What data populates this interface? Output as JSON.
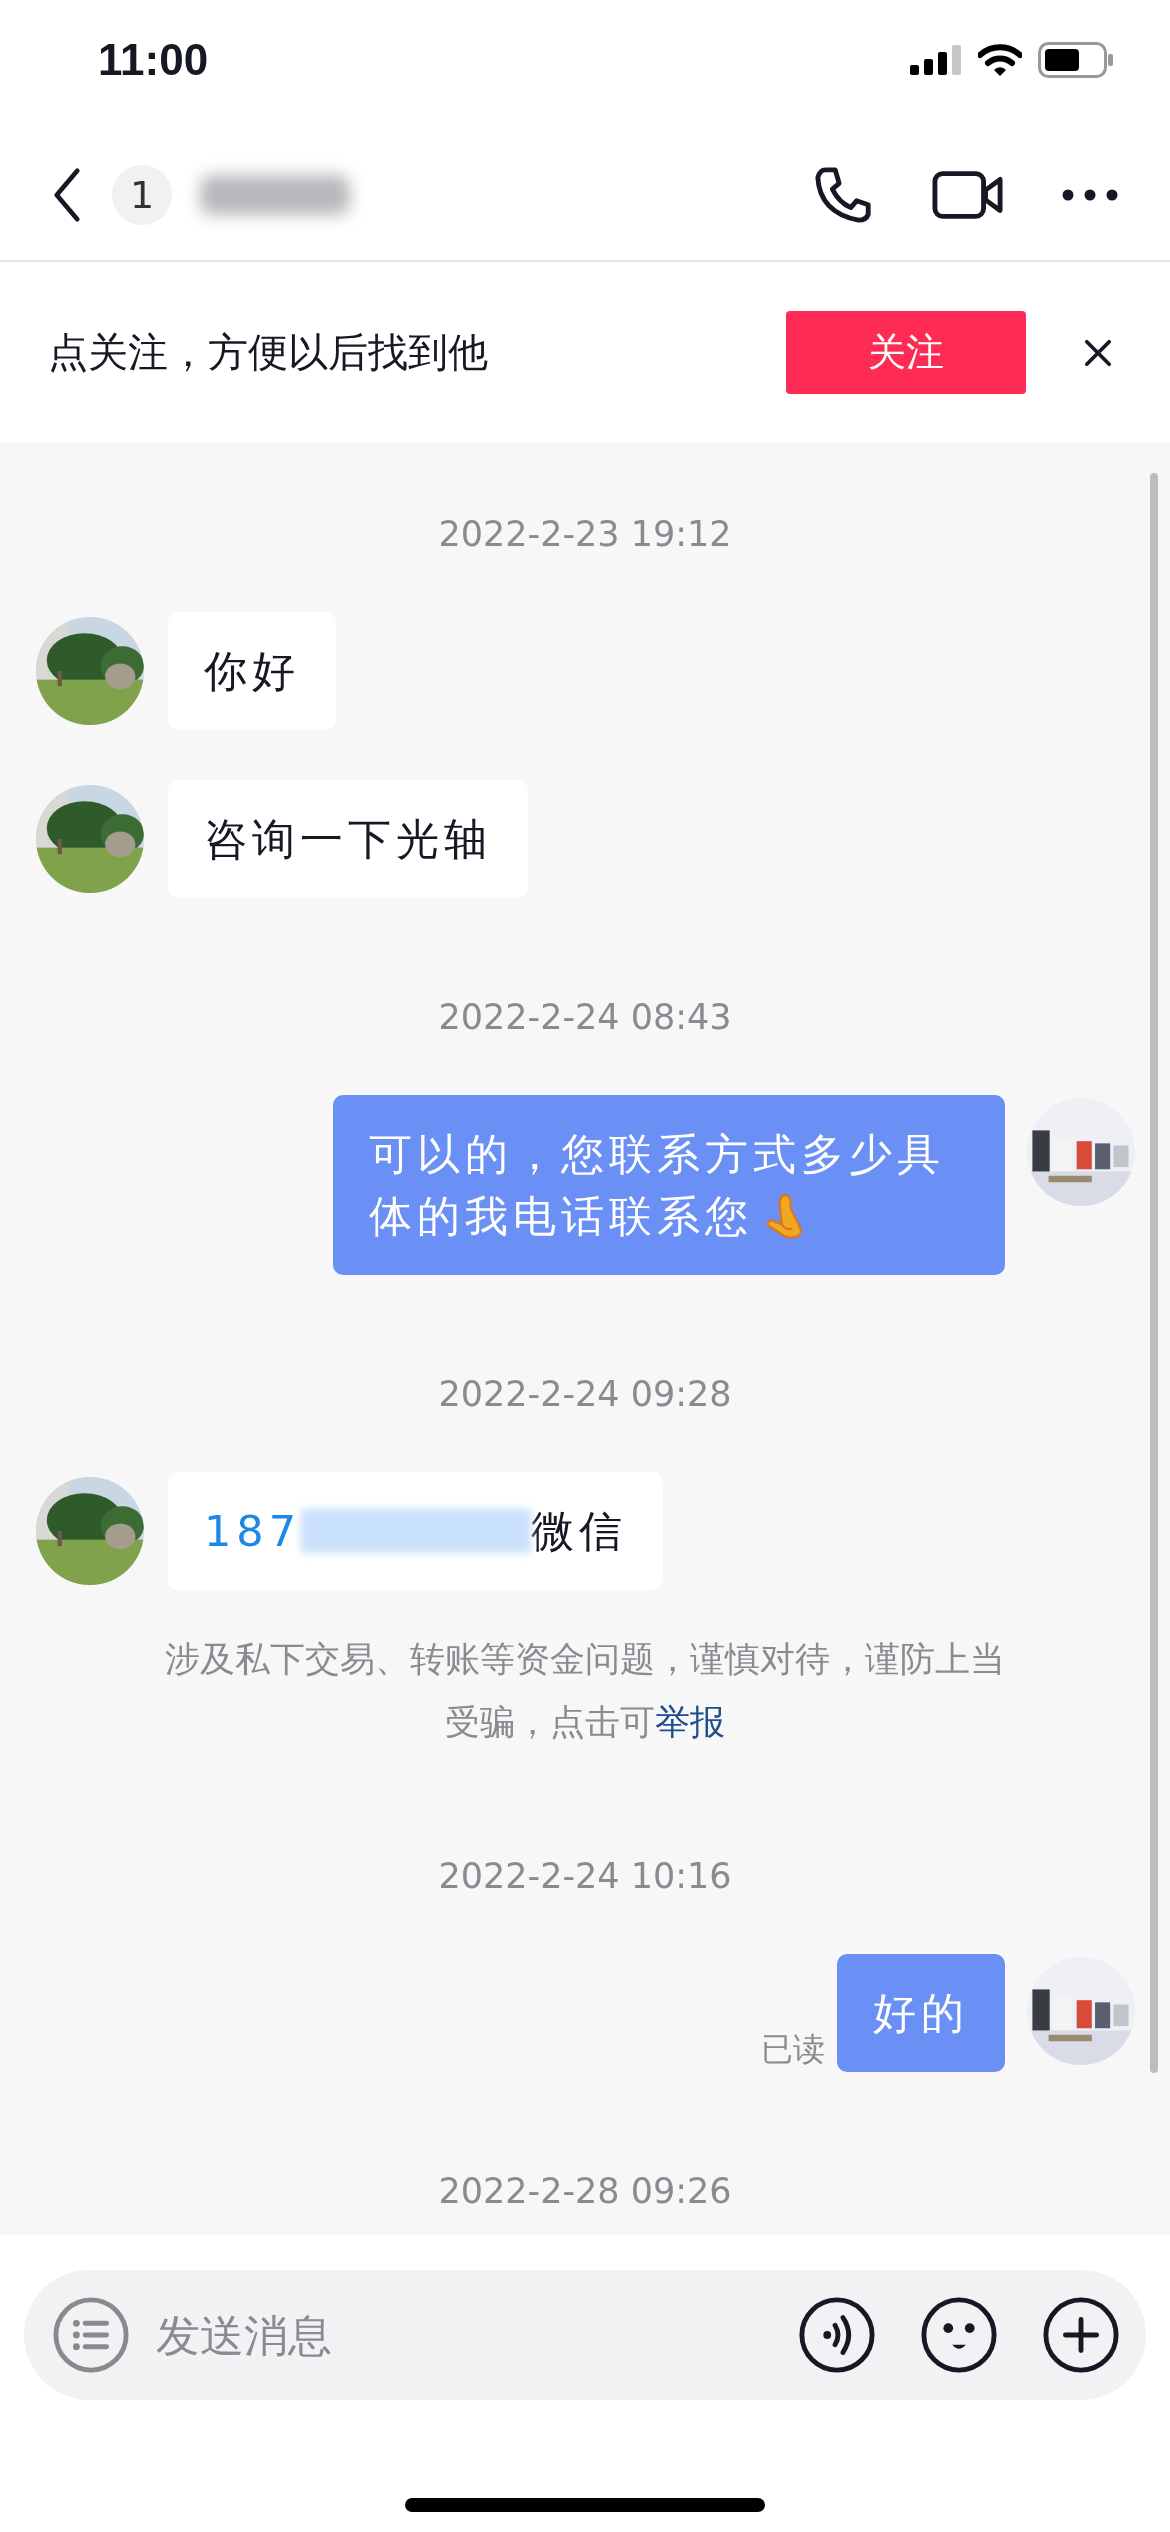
{
  "status_bar": {
    "time": "11:00"
  },
  "header": {
    "unread_count": "1"
  },
  "follow_banner": {
    "text": "点关注，方便以后找到他",
    "button": "关注"
  },
  "messages": [
    {
      "kind": "timestamp",
      "text": "2022-2-23 19:12"
    },
    {
      "kind": "received",
      "text": "你好"
    },
    {
      "kind": "received",
      "text": "咨询一下光轴"
    },
    {
      "kind": "timestamp",
      "text": "2022-2-24 08:43"
    },
    {
      "kind": "sent",
      "text": "可以的，您联系方式多少具体的我电话联系您",
      "emoji": true
    },
    {
      "kind": "timestamp",
      "text": "2022-2-24 09:28"
    },
    {
      "kind": "contact",
      "prefix": "187",
      "suffix": "微信"
    },
    {
      "kind": "notice",
      "text": "涉及私下交易、转账等资金问题，谨慎对待，谨防上当受骗，点击可",
      "link": "举报"
    },
    {
      "kind": "timestamp",
      "text": "2022-2-24 10:16"
    },
    {
      "kind": "sent",
      "text": "好的",
      "status": "已读"
    },
    {
      "kind": "timestamp",
      "text": "2022-2-28 09:26"
    }
  ],
  "composer": {
    "placeholder": "发送消息"
  }
}
